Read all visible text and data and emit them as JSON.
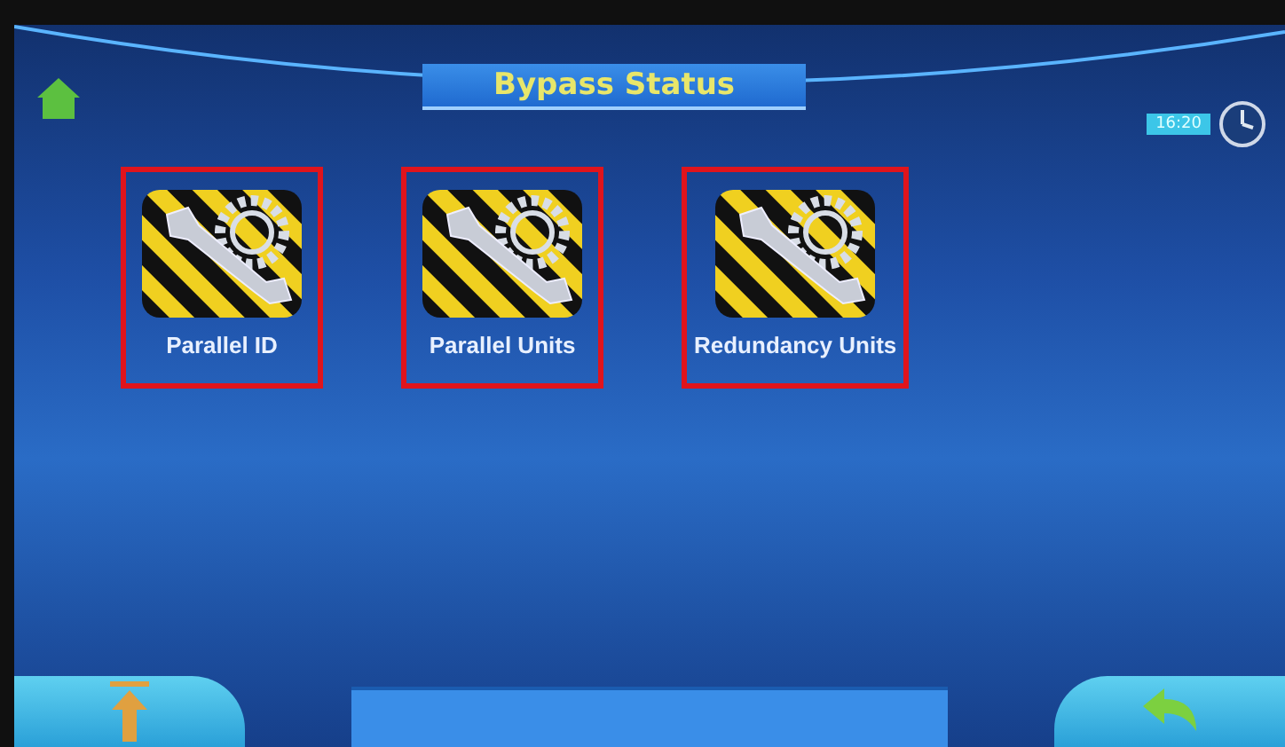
{
  "header": {
    "title": "Bypass Status",
    "time": "16:20"
  },
  "tiles": [
    {
      "label": "Parallel ID",
      "highlighted": true
    },
    {
      "label": "Parallel Units",
      "highlighted": true
    },
    {
      "label": "Redundancy Units",
      "highlighted": true
    }
  ]
}
